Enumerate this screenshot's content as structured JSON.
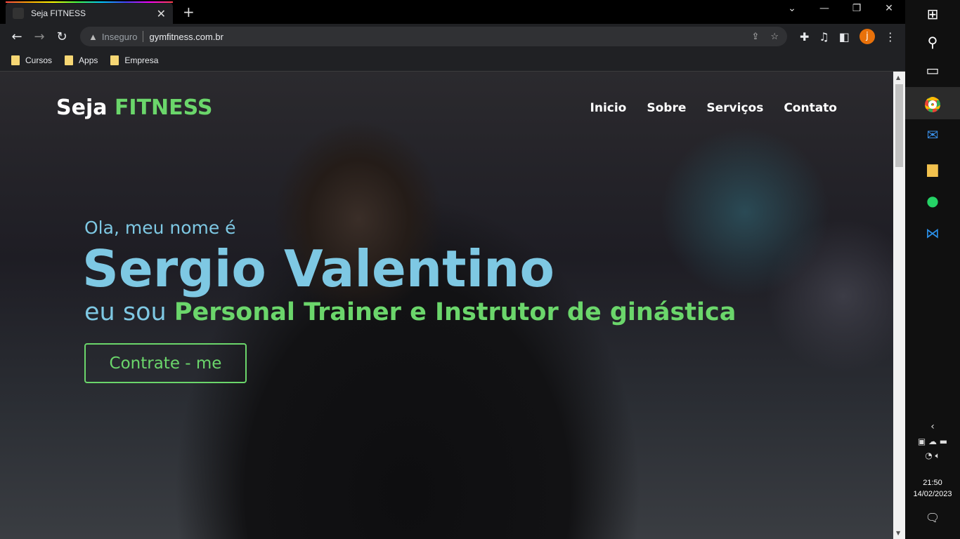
{
  "browser": {
    "tab_title": "Seja FITNESS",
    "insecure_label": "Inseguro",
    "url": "gymfitness.com.br",
    "profile_initial": "j",
    "bookmarks": [
      {
        "label": "Cursos"
      },
      {
        "label": "Apps"
      },
      {
        "label": "Empresa"
      }
    ]
  },
  "site": {
    "logo_primary": "Seja",
    "logo_accent": "FITNESS",
    "nav": [
      {
        "label": "Inicio"
      },
      {
        "label": "Sobre"
      },
      {
        "label": "Serviços"
      },
      {
        "label": "Contato"
      }
    ],
    "hero": {
      "greeting": "Ola, meu nome é",
      "name": "Sergio Valentino",
      "role_prefix": "eu sou",
      "role": "Personal Trainer e Instrutor de ginástica",
      "cta": "Contrate - me"
    },
    "colors": {
      "accent_green": "#6bd66b",
      "accent_blue": "#7ec8e3"
    }
  },
  "taskbar": {
    "time": "21:50",
    "date": "14/02/2023"
  }
}
